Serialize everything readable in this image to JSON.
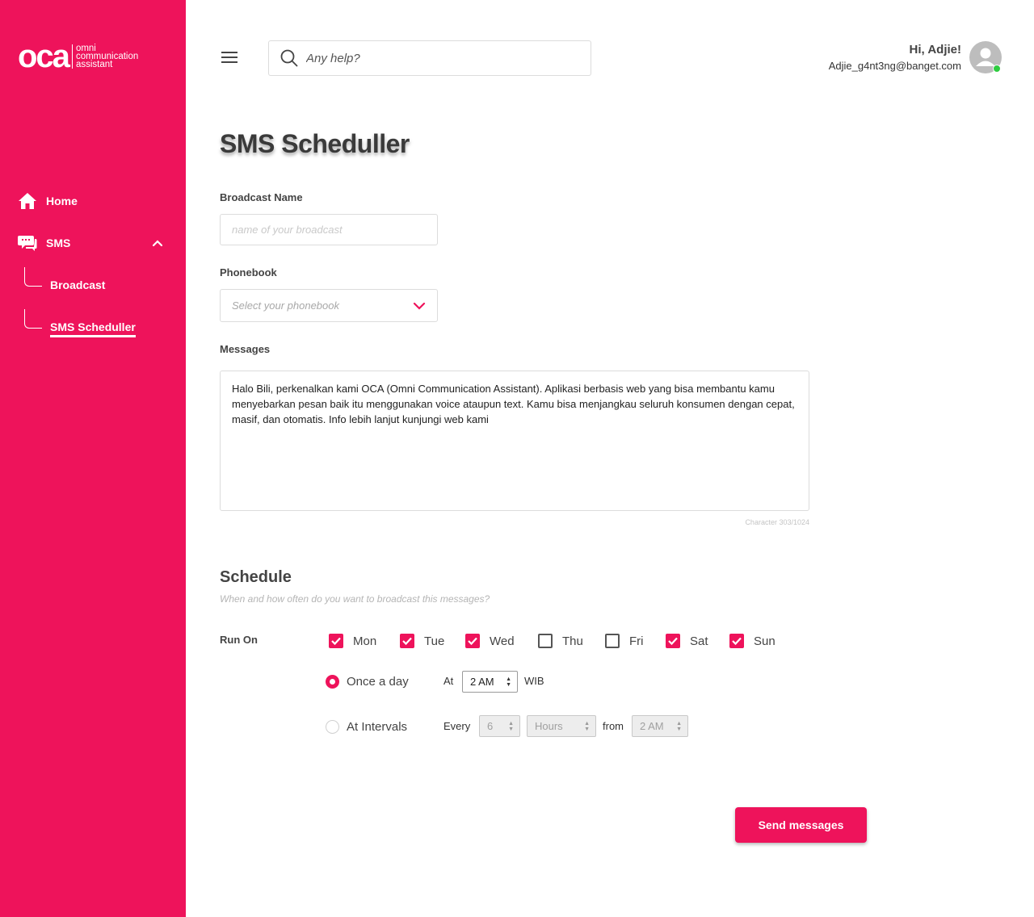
{
  "brand": {
    "mark": "oca",
    "line1": "omni",
    "line2": "communication",
    "line3": "assistant",
    "accent": "#ee135b"
  },
  "sidebar": {
    "items": [
      {
        "label": "Home",
        "icon": "home-icon"
      },
      {
        "label": "SMS",
        "icon": "chat-icon"
      }
    ],
    "sub_items": [
      {
        "label": "Broadcast"
      },
      {
        "label": "SMS Scheduller",
        "active": true
      }
    ]
  },
  "header": {
    "search_placeholder": "Any help?",
    "greeting": "Hi, Adjie!",
    "email": "Adjie_g4nt3ng@banget.com"
  },
  "main": {
    "title": "SMS Scheduller",
    "broadcast_name": {
      "label": "Broadcast Name",
      "placeholder": "name of your broadcast",
      "value": ""
    },
    "phonebook": {
      "label": "Phonebook",
      "placeholder": "Select your phonebook"
    },
    "messages": {
      "label": "Messages",
      "value": "Halo Bili, perkenalkan kami OCA (Omni Communication Assistant). Aplikasi berbasis web yang bisa membantu kamu menyebarkan pesan baik itu menggunakan voice ataupun text. Kamu bisa menjangkau seluruh konsumen dengan cepat, masif, dan otomatis. Info lebih lanjut kunjungi web kami",
      "char_count": "Character 303/1024"
    },
    "schedule": {
      "title": "Schedule",
      "subtitle": "When and how often do you want to broadcast this messages?",
      "run_on_label": "Run On",
      "days": [
        {
          "label": "Mon",
          "checked": true
        },
        {
          "label": "Tue",
          "checked": true
        },
        {
          "label": "Wed",
          "checked": true
        },
        {
          "label": "Thu",
          "checked": false
        },
        {
          "label": "Fri",
          "checked": false
        },
        {
          "label": "Sat",
          "checked": true
        },
        {
          "label": "Sun",
          "checked": true
        }
      ],
      "once": {
        "label": "Once a day",
        "selected": true,
        "at_label": "At",
        "time": "2 AM",
        "tz": "WIB"
      },
      "intervals": {
        "label": "At Intervals",
        "selected": false,
        "every_label": "Every",
        "every_value": "6",
        "unit": "Hours",
        "from_label": "from",
        "from_value": "2 AM"
      }
    },
    "send_button": "Send messages"
  }
}
